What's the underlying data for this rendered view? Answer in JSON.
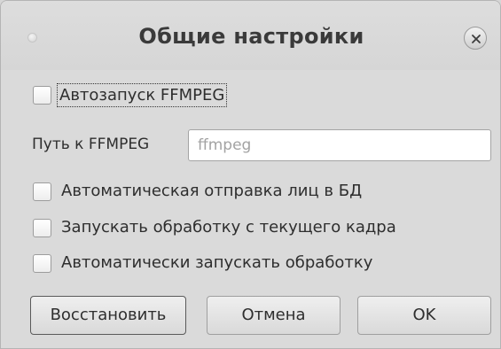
{
  "dialog": {
    "title": "Общие настройки"
  },
  "options": {
    "autostart_label": "Автозапуск FFMPEG",
    "path_label": "Путь к FFMPEG",
    "path_placeholder": "ffmpeg",
    "auto_send_label": "Автоматическая отправка лиц в БД",
    "from_current_frame_label": "Запускать обработку с текущего кадра",
    "auto_process_label": "Автоматически запускать обработку"
  },
  "buttons": {
    "restore": "Восстановить",
    "cancel": "Отмена",
    "ok": "OK"
  },
  "icons": {
    "close": "close-icon",
    "window": "window-dot-icon"
  }
}
